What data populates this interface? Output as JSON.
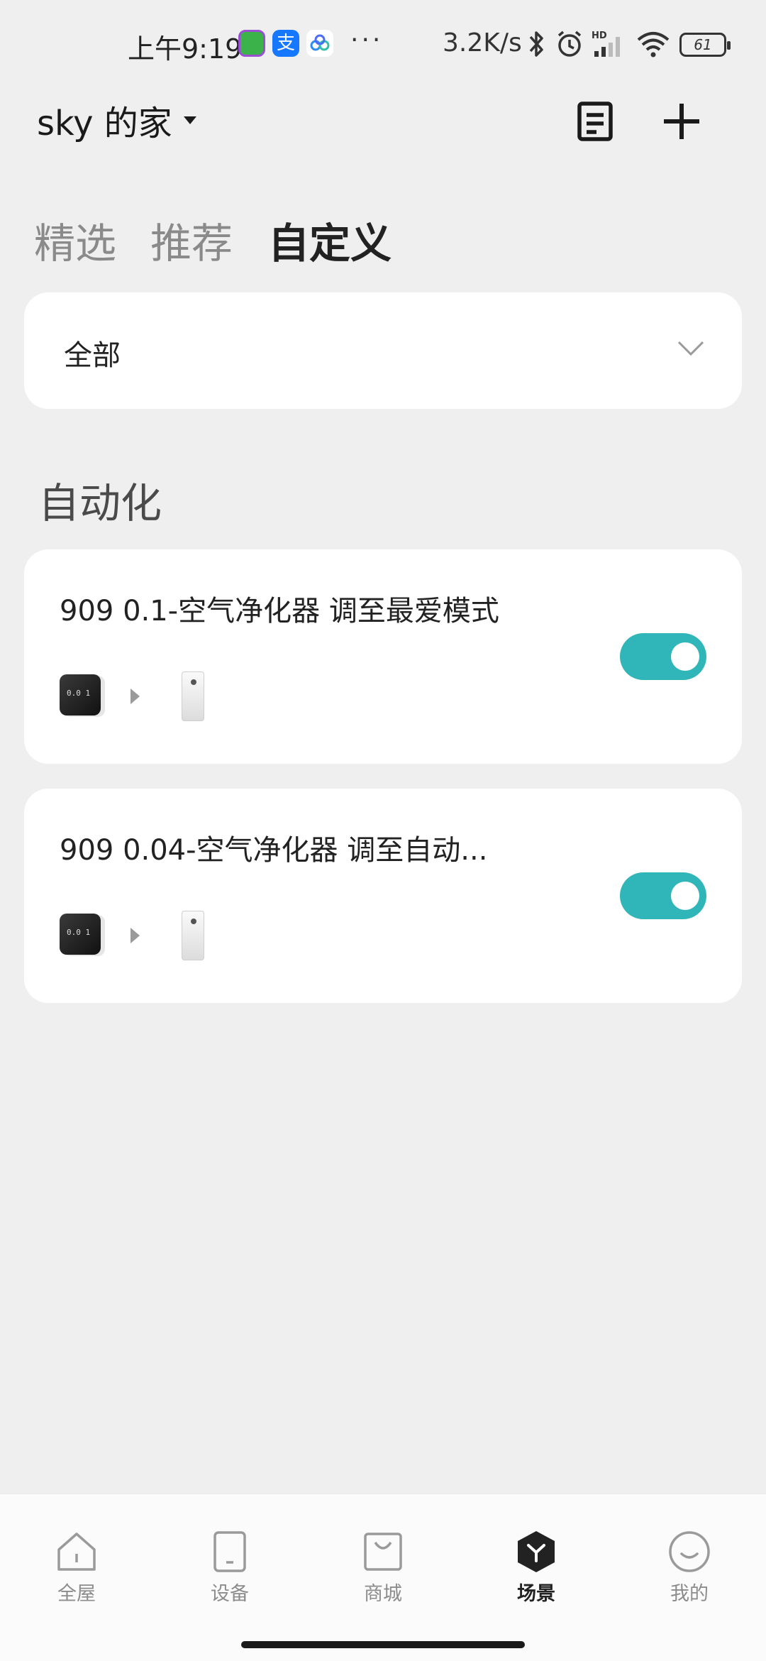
{
  "status_bar": {
    "time": "上午9:19",
    "net_speed": "3.2K/s",
    "battery": "61",
    "more": "···",
    "app_icons": [
      "melon-app-icon",
      "alipay-icon",
      "baidu-netdisk-icon"
    ],
    "indicators": [
      "bluetooth-icon",
      "alarm-icon",
      "hd-signal-icon",
      "wifi-icon"
    ]
  },
  "header": {
    "home_name": "sky 的家",
    "actions": [
      "log-icon",
      "add-icon"
    ]
  },
  "tabs": [
    {
      "label": "精选",
      "active": false
    },
    {
      "label": "推荐",
      "active": false
    },
    {
      "label": "自定义",
      "active": true
    }
  ],
  "filter": {
    "selected": "全部"
  },
  "section": {
    "title": "自动化"
  },
  "automations": [
    {
      "title": "909 0.1-空气净化器 调至最爱模式",
      "enabled": true
    },
    {
      "title": "909 0.04-空气净化器 调至自动...",
      "enabled": true
    }
  ],
  "device_icons": {
    "sensor_display": "0.0 1"
  },
  "bottom_nav": [
    {
      "label": "全屋",
      "icon": "house-icon",
      "active": false
    },
    {
      "label": "设备",
      "icon": "device-icon",
      "active": false
    },
    {
      "label": "商城",
      "icon": "shopping-bag-icon",
      "active": false
    },
    {
      "label": "场景",
      "icon": "scene-icon",
      "active": true
    },
    {
      "label": "我的",
      "icon": "profile-icon",
      "active": false
    }
  ],
  "colors": {
    "accent": "#30b6b8",
    "background": "#efefef",
    "card": "#ffffff"
  }
}
